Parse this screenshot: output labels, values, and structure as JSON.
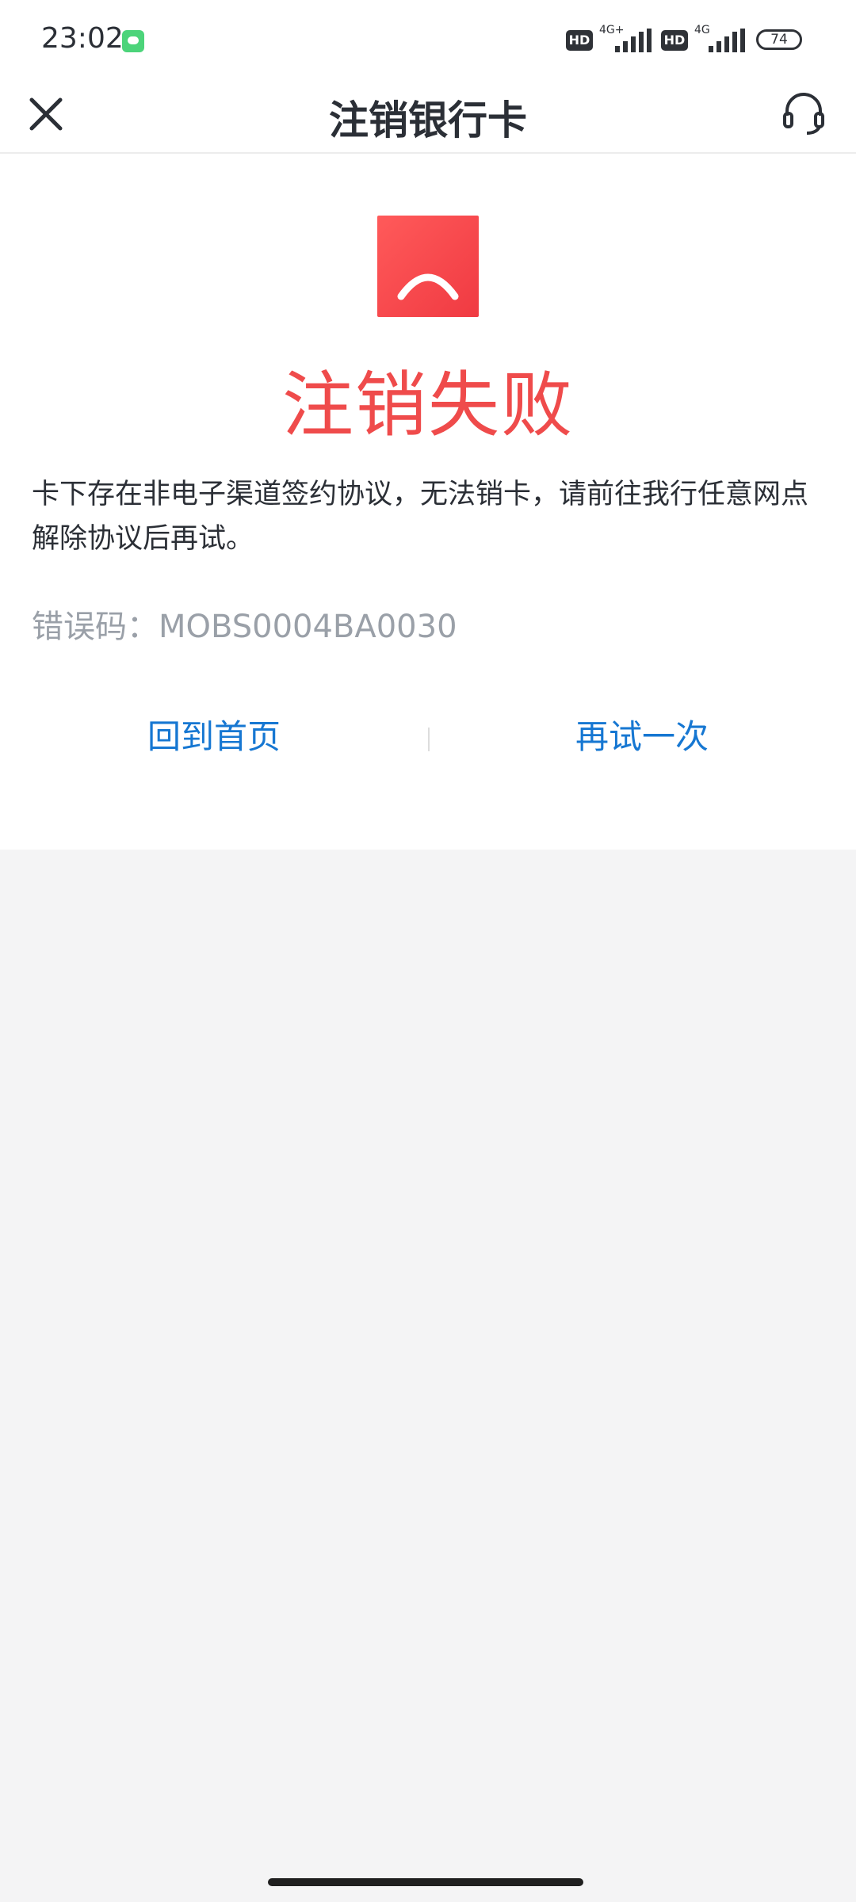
{
  "status_bar": {
    "time": "23:02",
    "hd_label": "HD",
    "network_1": "4G+",
    "network_2": "4G",
    "battery": "74"
  },
  "header": {
    "title": "注销银行卡"
  },
  "result": {
    "title": "注销失败",
    "message": "卡下存在非电子渠道签约协议，无法销卡，请前往我行任意网点解除协议后再试。",
    "error_code": "错误码：MOBS0004BA0030",
    "status_color": "#ef4b4b"
  },
  "actions": {
    "home_label": "回到首页",
    "retry_label": "再试一次",
    "link_color": "#1677d2"
  },
  "icons": {
    "close": "close-icon",
    "support": "headset-icon",
    "fail": "sad-face-icon"
  }
}
